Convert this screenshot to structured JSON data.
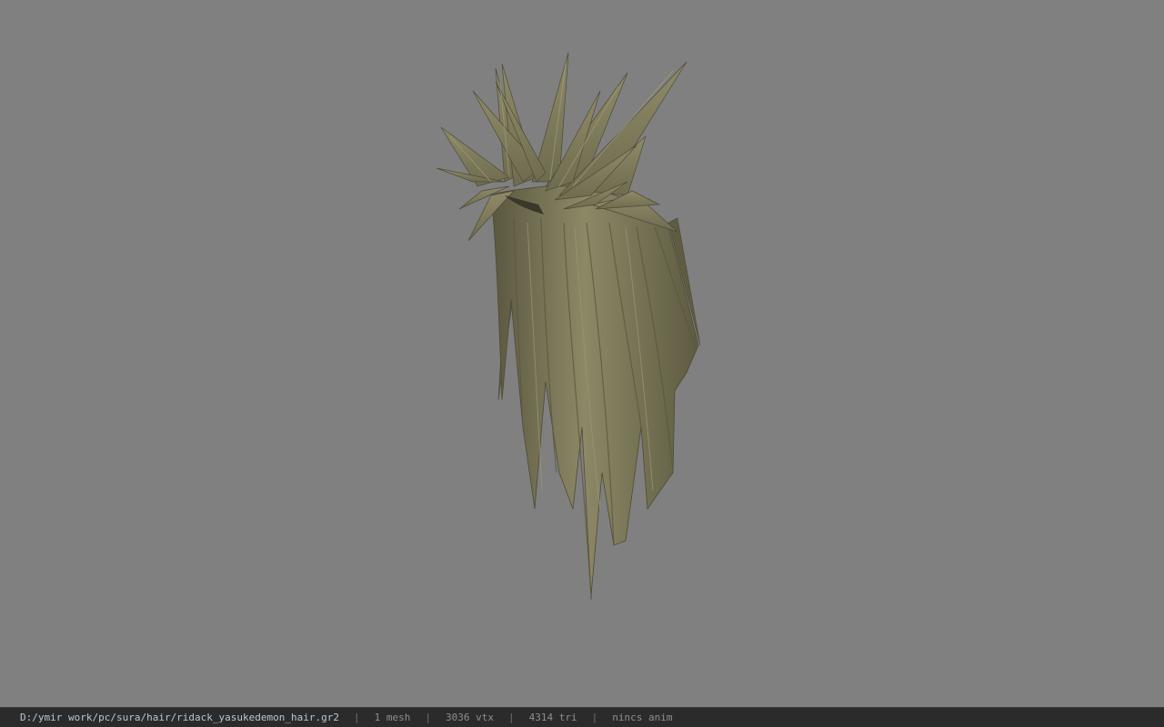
{
  "viewport": {
    "background": "#808080",
    "model": {
      "kind": "hair-mesh",
      "base_color": "#7f7c5c",
      "shadow_color": "#4d4a36",
      "highlight_color": "#9a9673"
    }
  },
  "statusbar": {
    "file_path": "D:/ymir work/pc/sura/hair/ridack_yasukedemon_hair.gr2",
    "separator": "|",
    "mesh_count": "1 mesh",
    "vertex_count": "3036 vtx",
    "triangle_count": "4314 tri",
    "anim_status": "nincs anim"
  }
}
